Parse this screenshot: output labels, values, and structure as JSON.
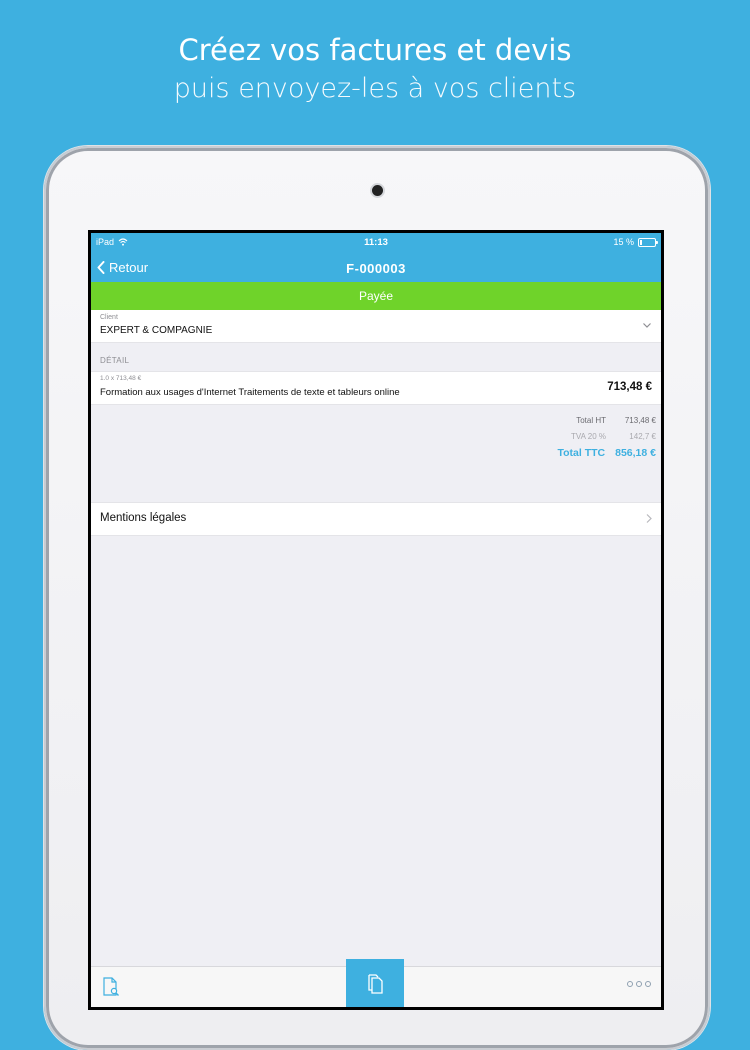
{
  "promo": {
    "line1": "Créez vos factures et devis",
    "line2": "puis envoyez-les à vos clients"
  },
  "status_bar": {
    "device": "iPad",
    "time": "11:13",
    "battery": "15 %",
    "battery_level": 0.15
  },
  "nav": {
    "back_label": "Retour",
    "title": "F-000003"
  },
  "banner": {
    "text": "Payée",
    "color": "#6fd32a"
  },
  "client": {
    "label": "Client",
    "value": "EXPERT & COMPAGNIE"
  },
  "detail": {
    "header": "DÉTAIL",
    "items": [
      {
        "qty_line": "1.0 x 713,48 €",
        "description": "Formation aux usages d'Internet Traitements de texte et tableurs online",
        "amount": "713,48 €"
      }
    ]
  },
  "totals": {
    "ht_label": "Total HT",
    "ht_value": "713,48 €",
    "tva_label": "TVA 20 %",
    "tva_value": "142,7 €",
    "ttc_label": "Total TTC",
    "ttc_value": "856,18 €"
  },
  "legal": {
    "label": "Mentions légales"
  },
  "toolbar": {
    "left_icon": "document-search-icon",
    "center_icon": "document-icon",
    "right_icon": "more-dots-icon"
  },
  "colors": {
    "accent": "#3eb0e0",
    "paid": "#6fd32a"
  }
}
